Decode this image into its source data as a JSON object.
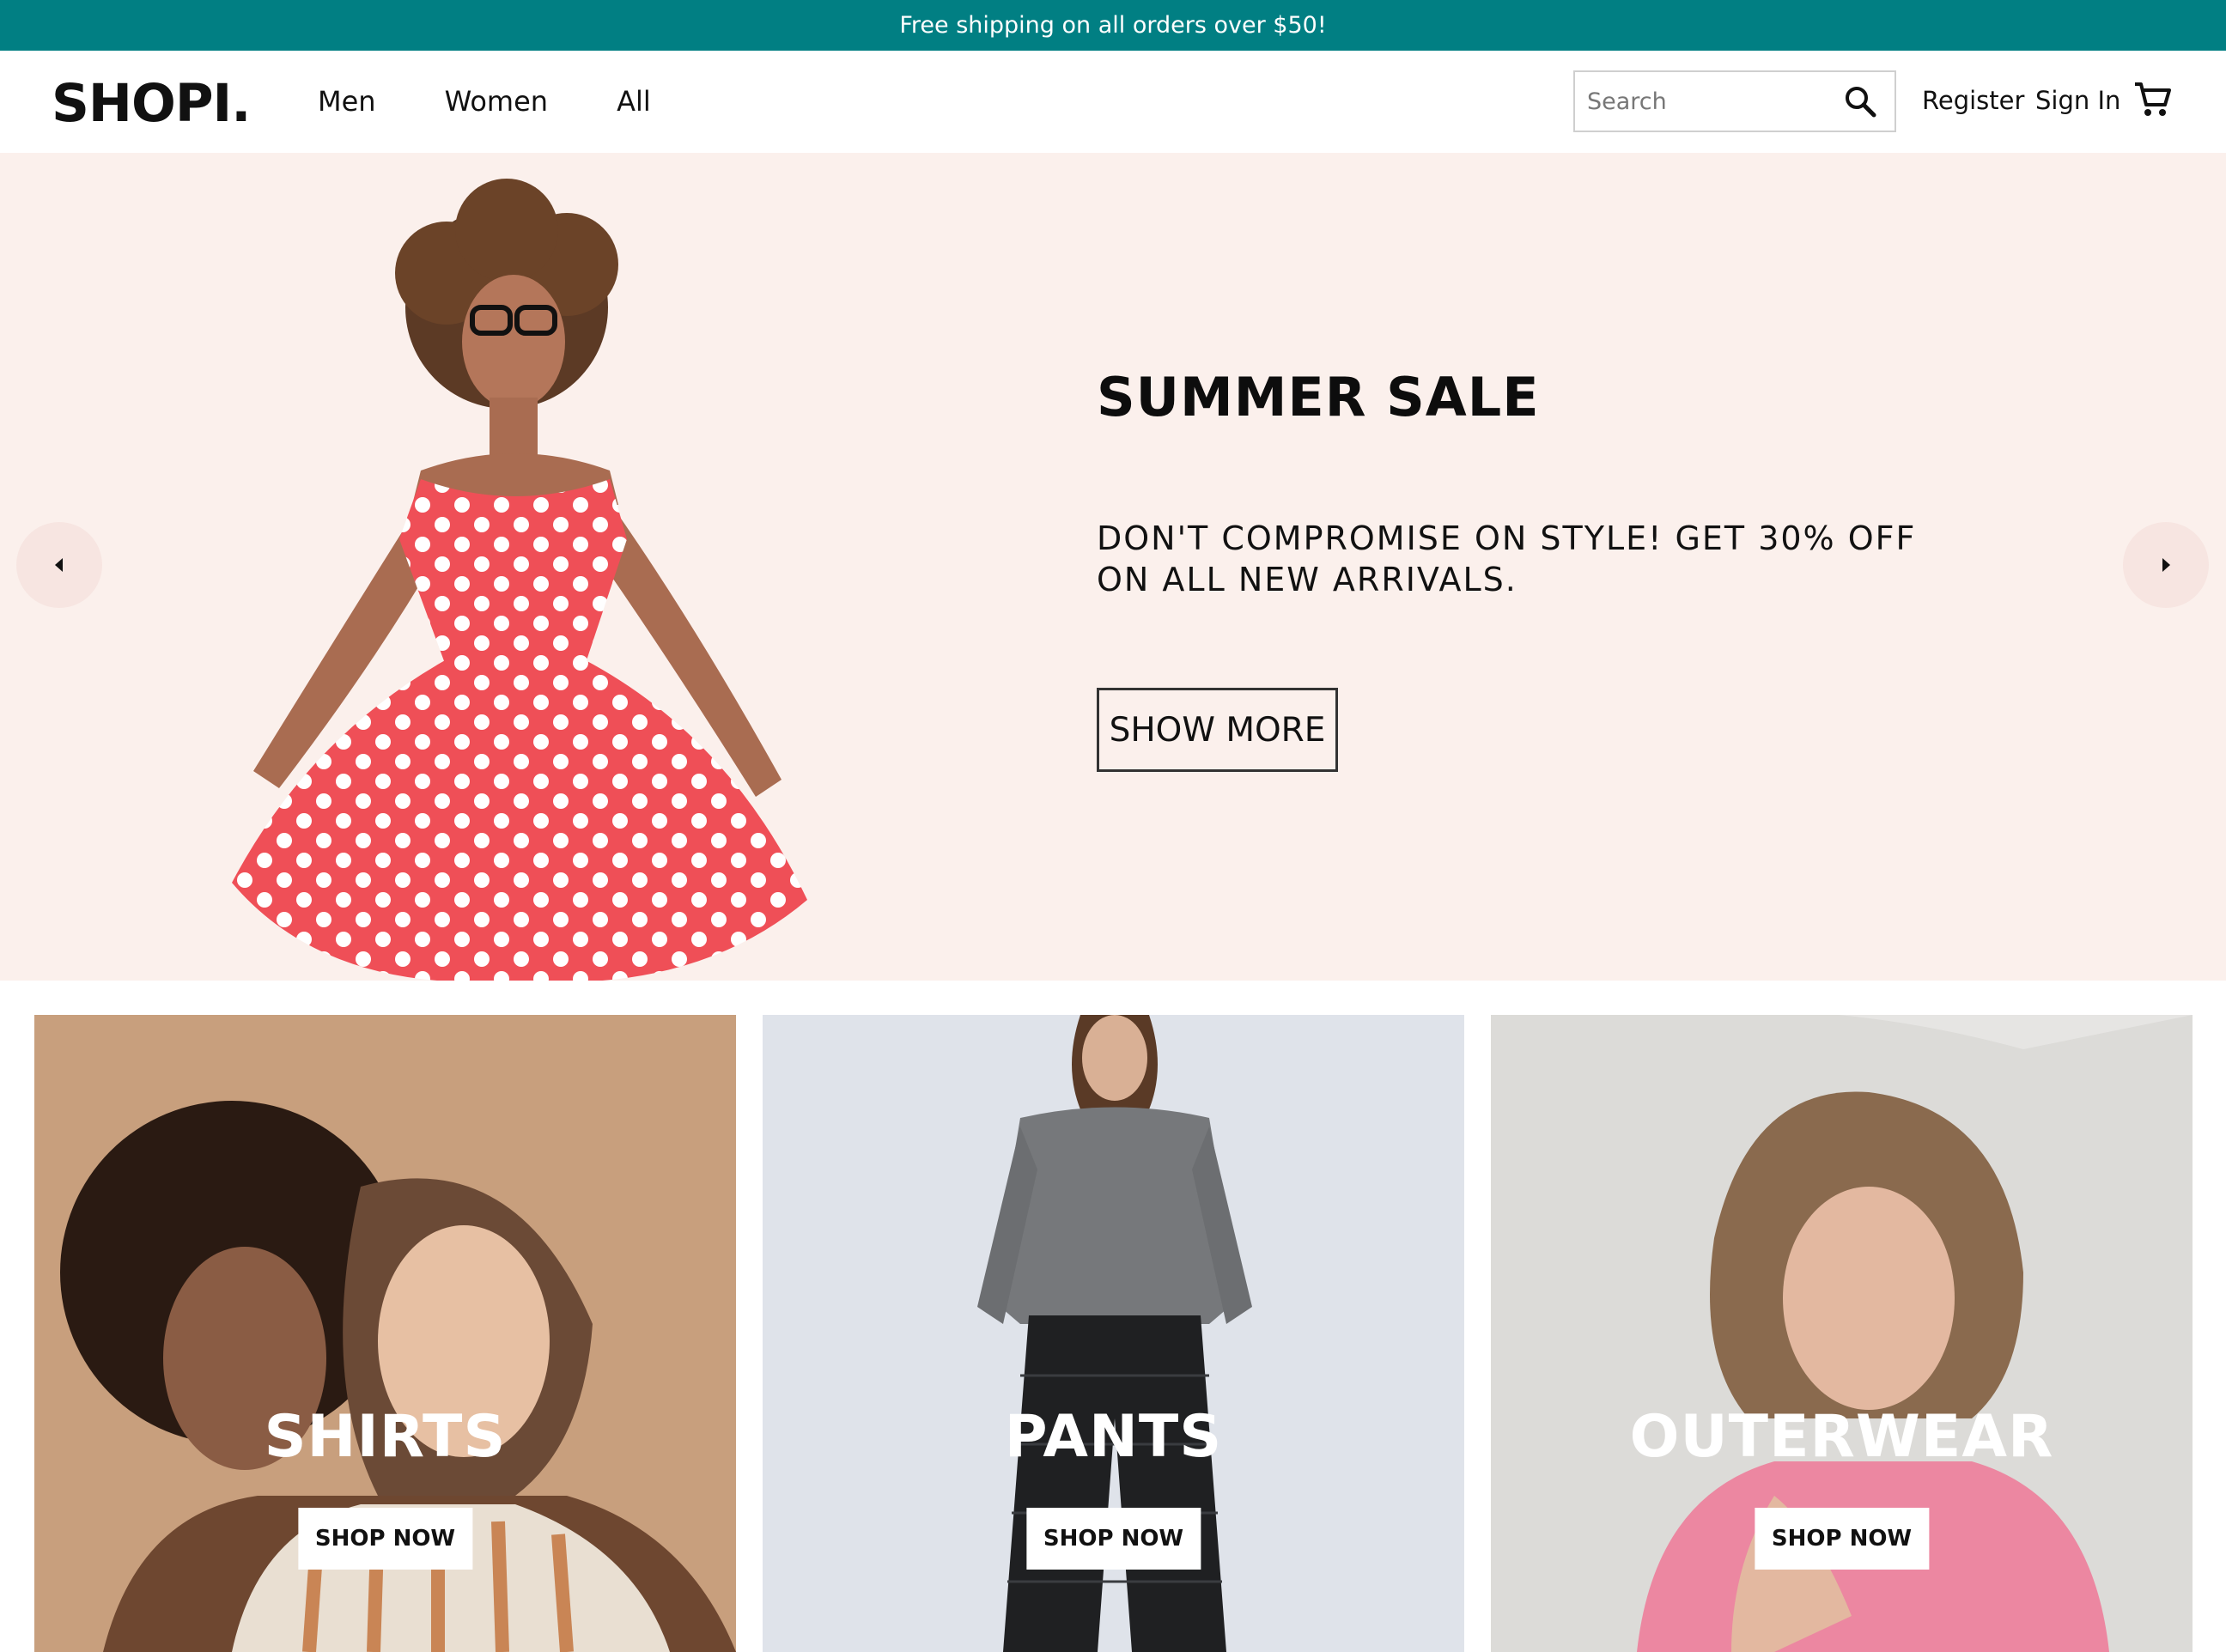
{
  "announcement": "Free shipping on all orders over $50!",
  "header": {
    "logo": "SHOPI.",
    "nav": [
      "Men",
      "Women",
      "All"
    ],
    "search_placeholder": "Search",
    "register": "Register",
    "sign_in": "Sign In"
  },
  "hero": {
    "title": "SUMMER SALE",
    "description": "DON'T COMPROMISE ON STYLE! GET 30% OFF ON ALL NEW ARRIVALS.",
    "button": "SHOW MORE"
  },
  "categories": [
    {
      "title": "SHIRTS",
      "button": "SHOP NOW"
    },
    {
      "title": "PANTS",
      "button": "SHOP NOW"
    },
    {
      "title": "OUTERWEAR",
      "button": "SHOP NOW"
    }
  ],
  "colors": {
    "announcement_bg": "#017f83",
    "hero_bg": "#fbf0ec",
    "dress": "#ef4f57"
  },
  "icons": [
    "search-icon",
    "cart-icon",
    "chevron-left-icon",
    "chevron-right-icon"
  ]
}
